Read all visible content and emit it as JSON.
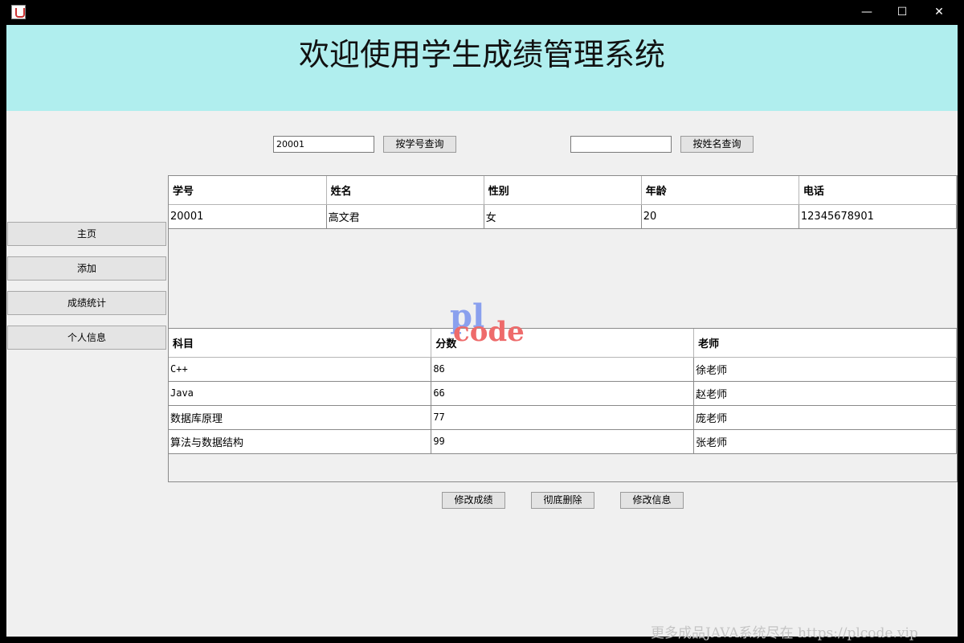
{
  "window": {
    "minimize_glyph": "—",
    "maximize_glyph": "☐",
    "close_glyph": "✕"
  },
  "header": {
    "title": "欢迎使用学生成绩管理系统"
  },
  "search": {
    "id_value": "20001",
    "id_button": "按学号查询",
    "name_value": "",
    "name_button": "按姓名查询"
  },
  "sidebar": {
    "items": [
      {
        "label": "主页"
      },
      {
        "label": "添加"
      },
      {
        "label": "成绩统计"
      },
      {
        "label": "个人信息"
      }
    ]
  },
  "student_table": {
    "headers": [
      "学号",
      "姓名",
      "性别",
      "年龄",
      "电话"
    ],
    "rows": [
      [
        "20001",
        "高文君",
        "女",
        "20",
        "12345678901"
      ]
    ]
  },
  "score_table": {
    "headers": [
      "科目",
      "分数",
      "老师"
    ],
    "rows": [
      [
        "C++",
        "86",
        "徐老师"
      ],
      [
        "Java",
        "66",
        "赵老师"
      ],
      [
        "数据库原理",
        "77",
        "庞老师"
      ],
      [
        "算法与数据结构",
        "99",
        "张老师"
      ]
    ]
  },
  "actions": {
    "edit_score": "修改成绩",
    "delete": "彻底删除",
    "edit_info": "修改信息"
  },
  "logo": {
    "top": "pl",
    "bottom": "code"
  },
  "watermark": "更多成品JAVA系统尽在 https://plcode.vip"
}
